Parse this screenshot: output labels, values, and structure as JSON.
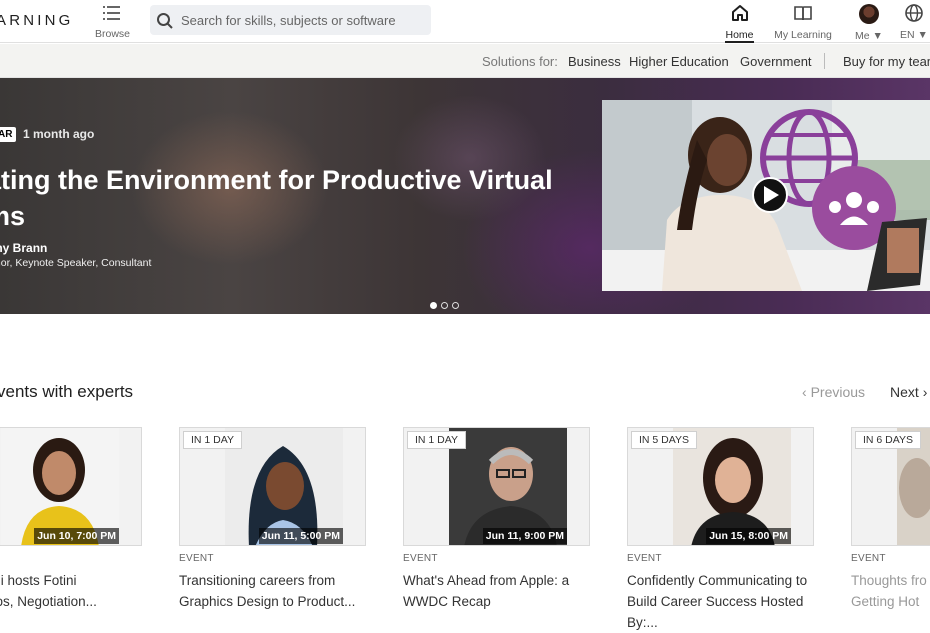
{
  "topnav": {
    "brand": "ARNING",
    "browse_label": "Browse",
    "search_placeholder": "Search for skills, subjects or software",
    "home_label": "Home",
    "mylearning_label": "My Learning",
    "me_label": "Me",
    "lang_label": "EN"
  },
  "solutions": {
    "label": "Solutions for:",
    "business": "Business",
    "higher_education": "Higher Education",
    "government": "Government",
    "buy": "Buy for my team"
  },
  "hero": {
    "badge": "AR",
    "time": "1 month ago",
    "title": "ating the Environment for Productive Virtual ms",
    "author": "my Brann",
    "role": "thor, Keynote Speaker, Consultant",
    "slides": 3,
    "active_slide": 1
  },
  "events": {
    "title": "vents with experts",
    "prev_label": "Previous",
    "next_label": "Next",
    "cards": [
      {
        "tag": "",
        "when": "Jun 10, 7:00 PM",
        "type": "",
        "title_line1": "Rezvani hosts Fotini",
        "title_line2": "nopoulos, Negotiation..."
      },
      {
        "tag": "IN 1 DAY",
        "when": "Jun 11, 5:00 PM",
        "type": "EVENT",
        "title_line1": "Transitioning careers from",
        "title_line2": "Graphics Design to Product..."
      },
      {
        "tag": "IN 1 DAY",
        "when": "Jun 11, 9:00 PM",
        "type": "EVENT",
        "title_line1": "What's Ahead from Apple: a",
        "title_line2": "WWDC Recap"
      },
      {
        "tag": "IN 5 DAYS",
        "when": "Jun 15, 8:00 PM",
        "type": "EVENT",
        "title_line1": "Confidently Communicating to",
        "title_line2": "Build Career Success Hosted By:..."
      },
      {
        "tag": "IN 6 DAYS",
        "when": "",
        "type": "EVENT",
        "title_line1": "Thoughts fro",
        "title_line2": "Getting Hot"
      }
    ]
  },
  "colors": {
    "accent_red": "#cc1016",
    "hero_purple": "#8a3f9a"
  }
}
